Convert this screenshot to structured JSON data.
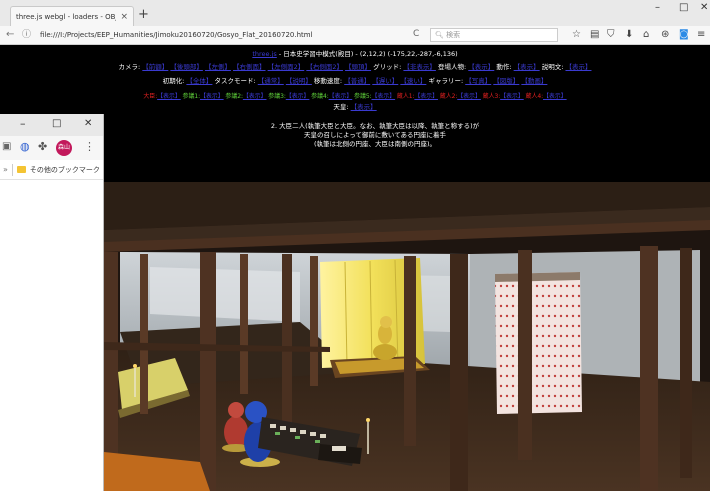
{
  "browser": {
    "tab_title": "three.js webgl - loaders - OBJ ...",
    "tab_close": "×",
    "new_tab": "+",
    "window_controls": {
      "minimize": "–",
      "maximize": "□",
      "close": "✕"
    },
    "url": "file:///I:/Projects/EEP_Humanities/Jimoku20160720/Gosyo_Flat_20160720.html",
    "reload": "C",
    "search_placeholder": "検索",
    "toolbar_icons": [
      "star-icon",
      "reader-icon",
      "shield-icon",
      "download-icon",
      "home-icon",
      "sync-icon",
      "extension-icon",
      "menu-icon"
    ]
  },
  "header": {
    "title_link": "three.js",
    "title_text": " - 日本史学習中模式(殿目)  - (2,12,2) (-175,22,-287,-6,136)",
    "camera_label": "カメラ:",
    "camera_links": [
      "【前額】",
      "【後頭部】",
      "【左側】",
      "【右側面】",
      "【左側面2】",
      "【右側面2】",
      "【頭頂】"
    ],
    "grid_label": "グリッド:",
    "grid_links": [
      "【非表示】"
    ],
    "people_label": "登場人物:",
    "people_links": [
      "【表示】"
    ],
    "motion_label": "動作:",
    "motion_links": [
      "【表示】"
    ],
    "desc_label": "説明文:",
    "desc_links": [
      "【表示】"
    ],
    "init_label": "初期化:",
    "init_links": [
      "【全体】"
    ],
    "task_label": "タスクモード:",
    "task_links": [
      "【通常】",
      "【説明】"
    ],
    "speed_label": "移動速度:",
    "speed_links": [
      "【普通】",
      "【遅い】",
      "【速い】"
    ],
    "gallery_label": "ギャラリー:",
    "gallery_links": [
      "【写真】",
      "【図版】",
      "【動画】"
    ],
    "seats": [
      {
        "label": "大臣:",
        "link": "【表示】",
        "color": "red"
      },
      {
        "label": "参議1:",
        "link": "【表示】",
        "color": "grn"
      },
      {
        "label": "参議2:",
        "link": "【表示】",
        "color": "grn"
      },
      {
        "label": "参議3:",
        "link": "【表示】",
        "color": "grn"
      },
      {
        "label": "参議4:",
        "link": "【表示】",
        "color": "grn"
      },
      {
        "label": "参議5:",
        "link": "【表示】",
        "color": "grn"
      },
      {
        "label": "蔵人1:",
        "link": "【表示】",
        "color": "red"
      },
      {
        "label": "蔵人2:",
        "link": "【表示】",
        "color": "red"
      },
      {
        "label": "蔵人3:",
        "link": "【表示】",
        "color": "red"
      },
      {
        "label": "蔵人4:",
        "link": "【表示】",
        "color": "red"
      }
    ],
    "emperor_label": "天皇:",
    "emperor_link": "【表示】"
  },
  "description": {
    "line1": "2. 大臣二人(執筆大臣と大臣。なお、執筆大臣は以降、執筆と称する)が",
    "line2": "天皇の召しによって御前に敷いてある円座に着手",
    "line3": "(執筆は北側の円座、大臣は南側の円座)。"
  },
  "overlay_window": {
    "controls": {
      "minimize": "–",
      "maximize": "□",
      "close": "✕"
    },
    "avatar_text": "森山",
    "bookmark_label": "その他のブックマーク"
  },
  "colors": {
    "floor": "#3a2a1c",
    "pillar": "#4e3222",
    "screen_gold": "#e6d23e",
    "figure_blue": "#1e40a8",
    "figure_gold": "#c8a52c",
    "figure_red": "#b03a30"
  }
}
